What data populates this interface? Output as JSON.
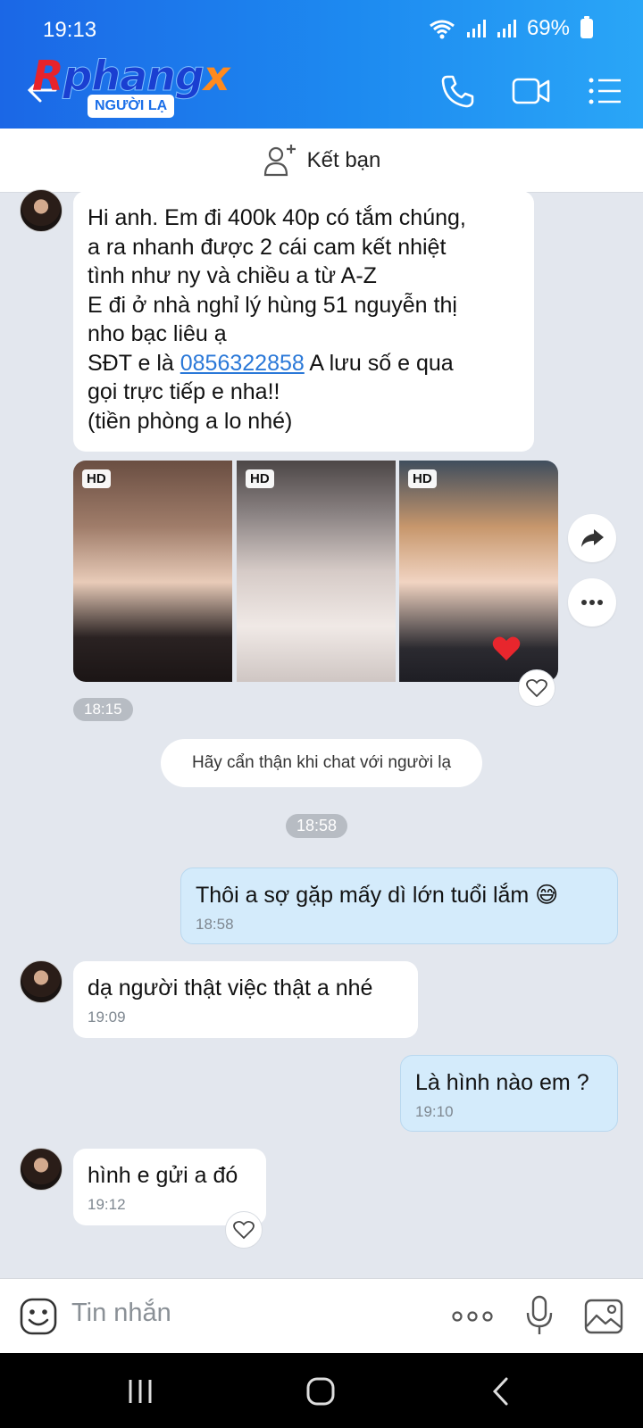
{
  "status": {
    "time": "19:13",
    "battery": "69%"
  },
  "header": {
    "logo": {
      "r": "R",
      "phang": "phang",
      "x": "x"
    },
    "stranger_badge": "NGƯỜI LẠ"
  },
  "add_friend": {
    "label": "Kết bạn"
  },
  "messages": {
    "m1": {
      "line1": "Hi anh. Em đi  400k 40p có tắm chúng,",
      "line2": "a ra nhanh được 2 cái cam kết nhiệt",
      "line3": "tình như ny và chiều a từ A-Z",
      "line4": "E đi ở nhà nghỉ lý hùng 51 nguyễn thị",
      "line5": "nho bạc liêu ạ",
      "line6_prefix": "SĐT e là ",
      "phone": "0856322858",
      "line6_suffix": " A lưu số e qua",
      "line7": "gọi trực tiếp e nha!!",
      "line8": "(tiền phòng a lo nhé)"
    },
    "photo_badges": [
      "HD",
      "HD",
      "HD"
    ],
    "time_1815": "18:15",
    "notice": "Hãy cẩn thận khi chat với người lạ",
    "time_1858": "18:58",
    "m2": {
      "text": "Thôi a sợ gặp mấy dì lớn tuổi lắm 😅",
      "time": "18:58"
    },
    "m3": {
      "text": "dạ người thật việc thật a nhé",
      "time": "19:09"
    },
    "m4": {
      "text": "Là hình nào em ?",
      "time": "19:10"
    },
    "m5": {
      "text": "hình e gửi a đó",
      "time": "19:12"
    }
  },
  "input": {
    "placeholder": "Tin nhắn"
  },
  "colors": {
    "header_start": "#1b67e6",
    "header_end": "#2aa6f7",
    "my_bubble": "#d4ebfb",
    "link": "#2a78d8"
  }
}
